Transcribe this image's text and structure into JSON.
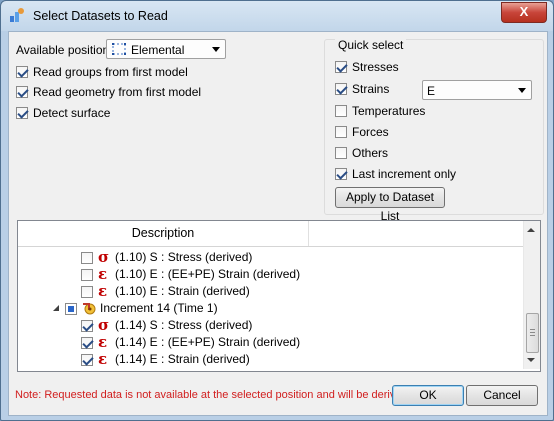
{
  "window": {
    "title": "Select Datasets to Read",
    "close_label": "X"
  },
  "positions": {
    "label": "Available positions:",
    "selected": "Elemental"
  },
  "options": {
    "read_groups": {
      "label": "Read groups from first model",
      "checked": true
    },
    "read_geometry": {
      "label": "Read geometry from first model",
      "checked": true
    },
    "detect_surface": {
      "label": "Detect surface",
      "checked": true
    }
  },
  "quick_select": {
    "title": "Quick select",
    "stresses": {
      "label": "Stresses",
      "checked": true
    },
    "strains": {
      "label": "Strains",
      "checked": true,
      "combo_value": "E"
    },
    "temperatures": {
      "label": "Temperatures",
      "checked": false
    },
    "forces": {
      "label": "Forces",
      "checked": false
    },
    "others": {
      "label": "Others",
      "checked": false
    },
    "last_increment": {
      "label": "Last increment only",
      "checked": true
    },
    "apply_label": "Apply to Dataset List"
  },
  "list": {
    "header": "Description",
    "rows": [
      {
        "symbol": "σ",
        "text": "(1.10) S :  Stress (derived)",
        "checked": false
      },
      {
        "symbol": "ε",
        "text": "(1.10) E :  (EE+PE) Strain (derived)",
        "checked": false
      },
      {
        "symbol": "ε",
        "text": "(1.10) E :  Strain (derived)",
        "checked": false
      },
      {
        "symbol": "",
        "text": "Increment 14 (Time 1)",
        "checked": true
      },
      {
        "symbol": "σ",
        "text": "(1.14) S :  Stress (derived)",
        "checked": true
      },
      {
        "symbol": "ε",
        "text": "(1.14) E :  (EE+PE) Strain (derived)",
        "checked": true
      },
      {
        "symbol": "ε",
        "text": "(1.14) E :  Strain (derived)",
        "checked": true
      }
    ]
  },
  "footer": {
    "note": "Note: Requested data is not available at the selected position and will be derived",
    "ok_label": "OK",
    "cancel_label": "Cancel"
  },
  "colors": {
    "note_red": "#d11e1e",
    "symbol_red": "#c00000",
    "accent_blue": "#2a4d85"
  }
}
